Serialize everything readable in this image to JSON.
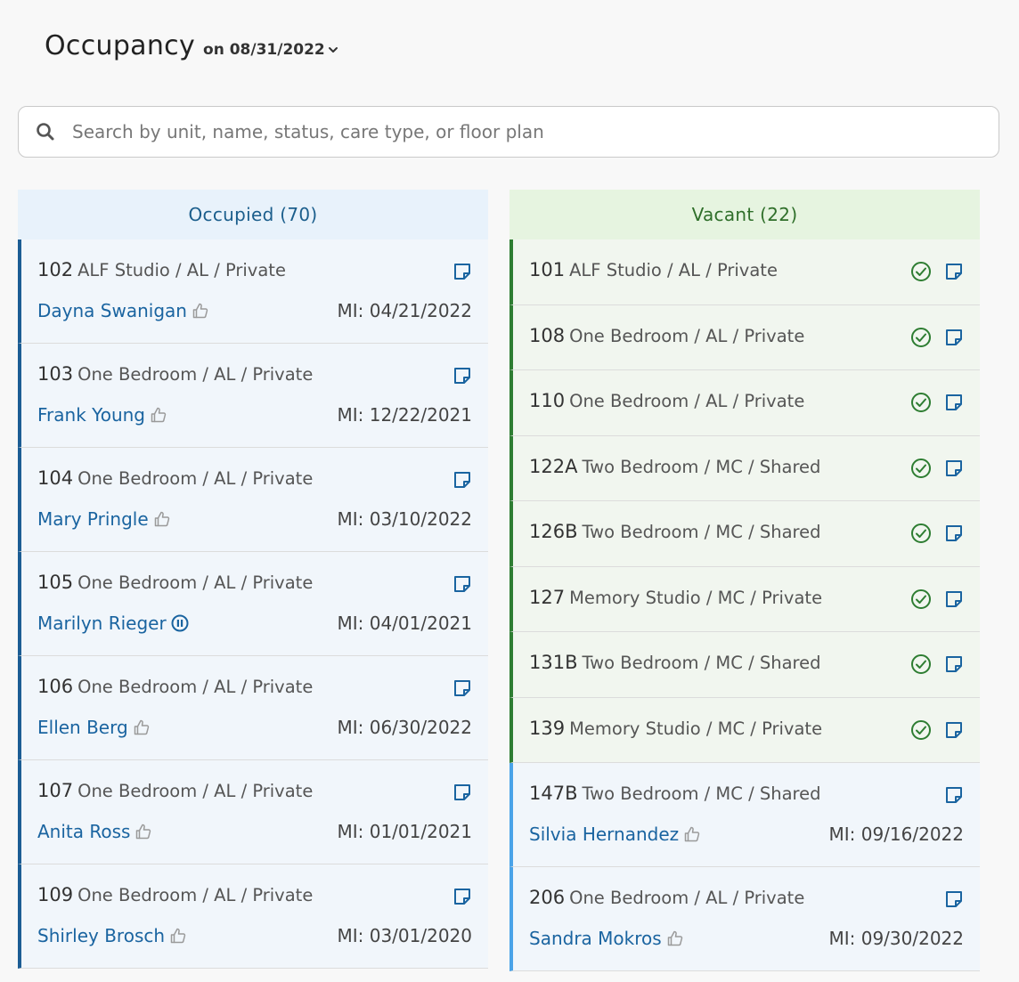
{
  "header": {
    "title": "Occupancy",
    "date_label": "on 08/31/2022"
  },
  "search": {
    "placeholder": "Search by unit, name, status, care type, or floor plan"
  },
  "occupied": {
    "title": "Occupied (70)",
    "cards": [
      {
        "unit": "102",
        "desc": "ALF Studio / AL / Private",
        "resident": "Dayna Swanigan",
        "status_icon": "thumbs-up-icon",
        "mi": "MI: 04/21/2022"
      },
      {
        "unit": "103",
        "desc": "One Bedroom / AL / Private",
        "resident": "Frank Young",
        "status_icon": "thumbs-up-icon",
        "mi": "MI: 12/22/2021"
      },
      {
        "unit": "104",
        "desc": "One Bedroom / AL / Private",
        "resident": "Mary Pringle",
        "status_icon": "thumbs-up-icon",
        "mi": "MI: 03/10/2022"
      },
      {
        "unit": "105",
        "desc": "One Bedroom / AL / Private",
        "resident": "Marilyn Rieger",
        "status_icon": "pause-icon",
        "mi": "MI: 04/01/2021"
      },
      {
        "unit": "106",
        "desc": "One Bedroom / AL / Private",
        "resident": "Ellen Berg",
        "status_icon": "thumbs-up-icon",
        "mi": "MI: 06/30/2022"
      },
      {
        "unit": "107",
        "desc": "One Bedroom / AL / Private",
        "resident": "Anita Ross",
        "status_icon": "thumbs-up-icon",
        "mi": "MI: 01/01/2021"
      },
      {
        "unit": "109",
        "desc": "One Bedroom / AL / Private",
        "resident": "Shirley Brosch",
        "status_icon": "thumbs-up-icon",
        "mi": "MI: 03/01/2020"
      }
    ]
  },
  "vacant": {
    "title": "Vacant (22)",
    "cards": [
      {
        "unit": "101",
        "desc": "ALF Studio / AL / Private"
      },
      {
        "unit": "108",
        "desc": "One Bedroom / AL / Private"
      },
      {
        "unit": "110",
        "desc": "One Bedroom / AL / Private"
      },
      {
        "unit": "122A",
        "desc": "Two Bedroom / MC / Shared"
      },
      {
        "unit": "126B",
        "desc": "Two Bedroom / MC / Shared"
      },
      {
        "unit": "127",
        "desc": "Memory Studio / MC / Private"
      },
      {
        "unit": "131B",
        "desc": "Two Bedroom / MC / Shared"
      },
      {
        "unit": "139",
        "desc": "Memory Studio / MC / Private"
      }
    ],
    "pending_cards": [
      {
        "unit": "147B",
        "desc": "Two Bedroom / MC / Shared",
        "resident": "Silvia Hernandez",
        "status_icon": "thumbs-up-icon",
        "mi": "MI: 09/16/2022"
      },
      {
        "unit": "206",
        "desc": "One Bedroom / AL / Private",
        "resident": "Sandra Mokros",
        "status_icon": "thumbs-up-icon",
        "mi": "MI: 09/30/2022"
      }
    ]
  },
  "colors": {
    "occupied_accent": "#1c5d94",
    "vacant_accent": "#2e7d32",
    "pending_accent": "#4aa3e8",
    "link": "#1a64a0"
  }
}
